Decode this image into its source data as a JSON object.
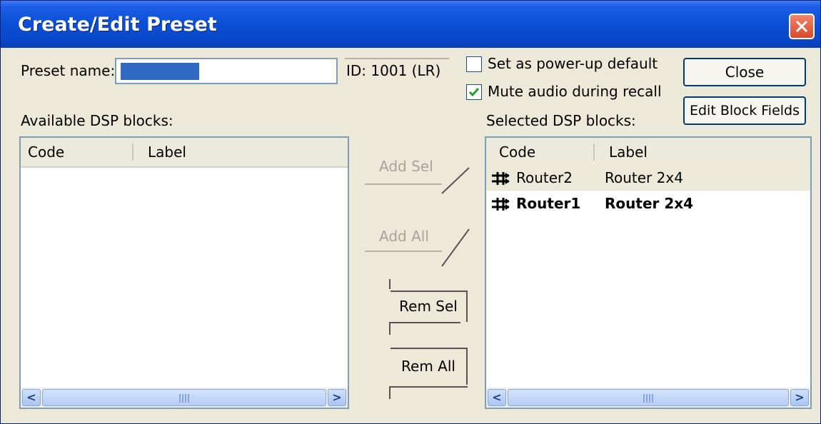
{
  "dialog": {
    "title": "Create/Edit Preset"
  },
  "preset": {
    "name_label": "Preset name:",
    "name_value": "",
    "id_label": "ID: 1001 (LR)"
  },
  "options": {
    "power_up": {
      "label": "Set as power-up default",
      "checked": false
    },
    "mute": {
      "label": "Mute audio during recall",
      "checked": true
    }
  },
  "buttons": {
    "close": "Close",
    "edit_fields": "Edit Block Fields",
    "add_sel": "Add Sel",
    "add_all": "Add All",
    "rem_sel": "Rem Sel",
    "rem_all": "Rem All"
  },
  "available": {
    "label": "Available DSP blocks:",
    "columns": [
      "Code",
      "Label"
    ],
    "rows": []
  },
  "selected": {
    "label": "Selected DSP blocks:",
    "columns": [
      "Code",
      "Label"
    ],
    "rows": [
      {
        "code": "Router2",
        "label": "Router  2x4",
        "icon": "router-icon",
        "bold": false,
        "highlighted": true
      },
      {
        "code": "Router1",
        "label": "Router  2x4",
        "icon": "router-icon",
        "bold": true,
        "highlighted": false
      }
    ]
  },
  "scrollbar": {
    "left_arrow": "<",
    "right_arrow": ">"
  }
}
